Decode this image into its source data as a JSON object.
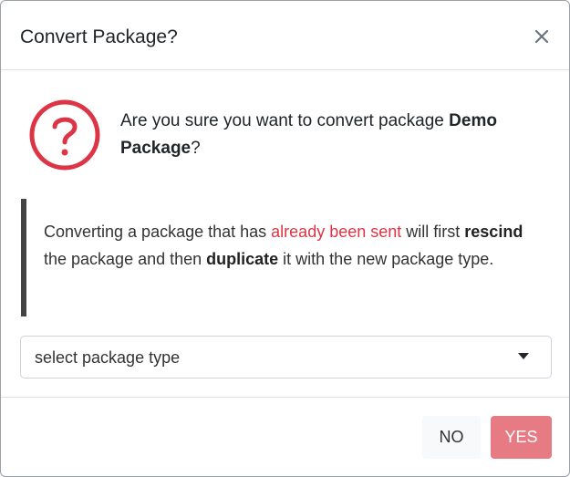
{
  "modal": {
    "title": "Convert Package?",
    "close_label": "×"
  },
  "prompt": {
    "text_before": "Are you sure you want to convert package ",
    "package_name": "Demo Package",
    "text_after": "?"
  },
  "warning": {
    "part1": "Converting a package that has ",
    "highlight": "already been sent",
    "part2": " will first ",
    "bold1": "rescind",
    "part3": " the package and then ",
    "bold2": "duplicate",
    "part4": " it with the new package type."
  },
  "package_type_select": {
    "selected": "select package type"
  },
  "footer": {
    "no_label": "NO",
    "yes_label": "YES"
  },
  "colors": {
    "danger": "#dc3545",
    "yes_button": "#e77b83",
    "no_button": "#f8f9fa",
    "blockquote_border": "#444444"
  },
  "icons": {
    "close": "close-icon",
    "question": "question-circle-icon",
    "caret": "caret-down-icon"
  }
}
